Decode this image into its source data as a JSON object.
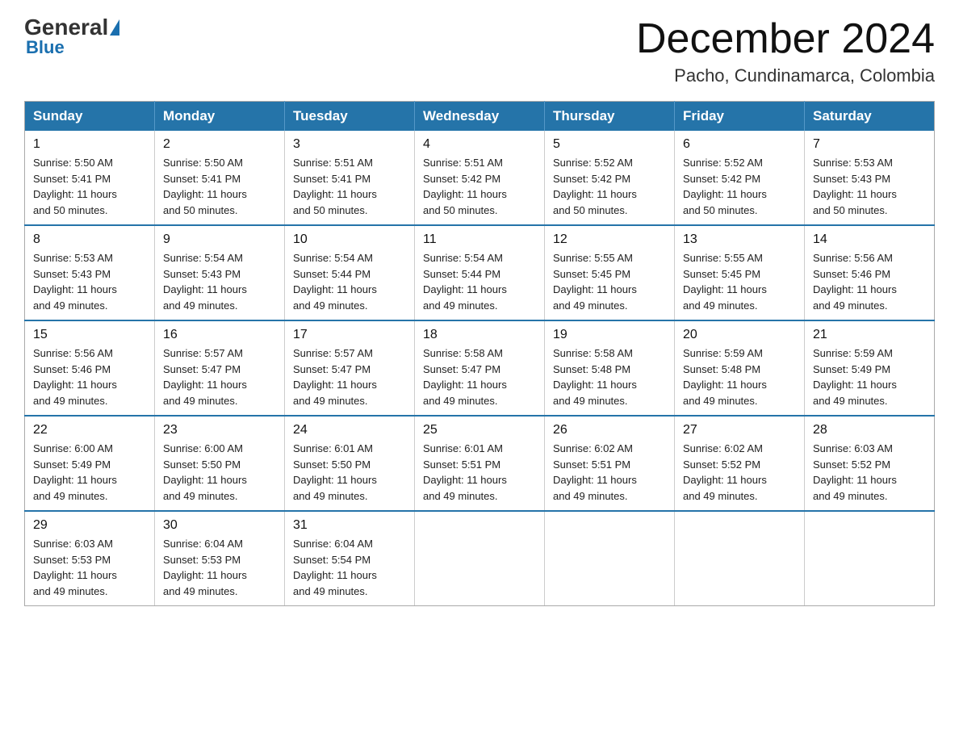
{
  "logo": {
    "general": "General",
    "blue": "Blue"
  },
  "header": {
    "month": "December 2024",
    "location": "Pacho, Cundinamarca, Colombia"
  },
  "weekdays": [
    "Sunday",
    "Monday",
    "Tuesday",
    "Wednesday",
    "Thursday",
    "Friday",
    "Saturday"
  ],
  "weeks": [
    [
      {
        "day": "1",
        "sunrise": "5:50 AM",
        "sunset": "5:41 PM",
        "daylight": "11 hours and 50 minutes."
      },
      {
        "day": "2",
        "sunrise": "5:50 AM",
        "sunset": "5:41 PM",
        "daylight": "11 hours and 50 minutes."
      },
      {
        "day": "3",
        "sunrise": "5:51 AM",
        "sunset": "5:41 PM",
        "daylight": "11 hours and 50 minutes."
      },
      {
        "day": "4",
        "sunrise": "5:51 AM",
        "sunset": "5:42 PM",
        "daylight": "11 hours and 50 minutes."
      },
      {
        "day": "5",
        "sunrise": "5:52 AM",
        "sunset": "5:42 PM",
        "daylight": "11 hours and 50 minutes."
      },
      {
        "day": "6",
        "sunrise": "5:52 AM",
        "sunset": "5:42 PM",
        "daylight": "11 hours and 50 minutes."
      },
      {
        "day": "7",
        "sunrise": "5:53 AM",
        "sunset": "5:43 PM",
        "daylight": "11 hours and 50 minutes."
      }
    ],
    [
      {
        "day": "8",
        "sunrise": "5:53 AM",
        "sunset": "5:43 PM",
        "daylight": "11 hours and 49 minutes."
      },
      {
        "day": "9",
        "sunrise": "5:54 AM",
        "sunset": "5:43 PM",
        "daylight": "11 hours and 49 minutes."
      },
      {
        "day": "10",
        "sunrise": "5:54 AM",
        "sunset": "5:44 PM",
        "daylight": "11 hours and 49 minutes."
      },
      {
        "day": "11",
        "sunrise": "5:54 AM",
        "sunset": "5:44 PM",
        "daylight": "11 hours and 49 minutes."
      },
      {
        "day": "12",
        "sunrise": "5:55 AM",
        "sunset": "5:45 PM",
        "daylight": "11 hours and 49 minutes."
      },
      {
        "day": "13",
        "sunrise": "5:55 AM",
        "sunset": "5:45 PM",
        "daylight": "11 hours and 49 minutes."
      },
      {
        "day": "14",
        "sunrise": "5:56 AM",
        "sunset": "5:46 PM",
        "daylight": "11 hours and 49 minutes."
      }
    ],
    [
      {
        "day": "15",
        "sunrise": "5:56 AM",
        "sunset": "5:46 PM",
        "daylight": "11 hours and 49 minutes."
      },
      {
        "day": "16",
        "sunrise": "5:57 AM",
        "sunset": "5:47 PM",
        "daylight": "11 hours and 49 minutes."
      },
      {
        "day": "17",
        "sunrise": "5:57 AM",
        "sunset": "5:47 PM",
        "daylight": "11 hours and 49 minutes."
      },
      {
        "day": "18",
        "sunrise": "5:58 AM",
        "sunset": "5:47 PM",
        "daylight": "11 hours and 49 minutes."
      },
      {
        "day": "19",
        "sunrise": "5:58 AM",
        "sunset": "5:48 PM",
        "daylight": "11 hours and 49 minutes."
      },
      {
        "day": "20",
        "sunrise": "5:59 AM",
        "sunset": "5:48 PM",
        "daylight": "11 hours and 49 minutes."
      },
      {
        "day": "21",
        "sunrise": "5:59 AM",
        "sunset": "5:49 PM",
        "daylight": "11 hours and 49 minutes."
      }
    ],
    [
      {
        "day": "22",
        "sunrise": "6:00 AM",
        "sunset": "5:49 PM",
        "daylight": "11 hours and 49 minutes."
      },
      {
        "day": "23",
        "sunrise": "6:00 AM",
        "sunset": "5:50 PM",
        "daylight": "11 hours and 49 minutes."
      },
      {
        "day": "24",
        "sunrise": "6:01 AM",
        "sunset": "5:50 PM",
        "daylight": "11 hours and 49 minutes."
      },
      {
        "day": "25",
        "sunrise": "6:01 AM",
        "sunset": "5:51 PM",
        "daylight": "11 hours and 49 minutes."
      },
      {
        "day": "26",
        "sunrise": "6:02 AM",
        "sunset": "5:51 PM",
        "daylight": "11 hours and 49 minutes."
      },
      {
        "day": "27",
        "sunrise": "6:02 AM",
        "sunset": "5:52 PM",
        "daylight": "11 hours and 49 minutes."
      },
      {
        "day": "28",
        "sunrise": "6:03 AM",
        "sunset": "5:52 PM",
        "daylight": "11 hours and 49 minutes."
      }
    ],
    [
      {
        "day": "29",
        "sunrise": "6:03 AM",
        "sunset": "5:53 PM",
        "daylight": "11 hours and 49 minutes."
      },
      {
        "day": "30",
        "sunrise": "6:04 AM",
        "sunset": "5:53 PM",
        "daylight": "11 hours and 49 minutes."
      },
      {
        "day": "31",
        "sunrise": "6:04 AM",
        "sunset": "5:54 PM",
        "daylight": "11 hours and 49 minutes."
      },
      null,
      null,
      null,
      null
    ]
  ]
}
